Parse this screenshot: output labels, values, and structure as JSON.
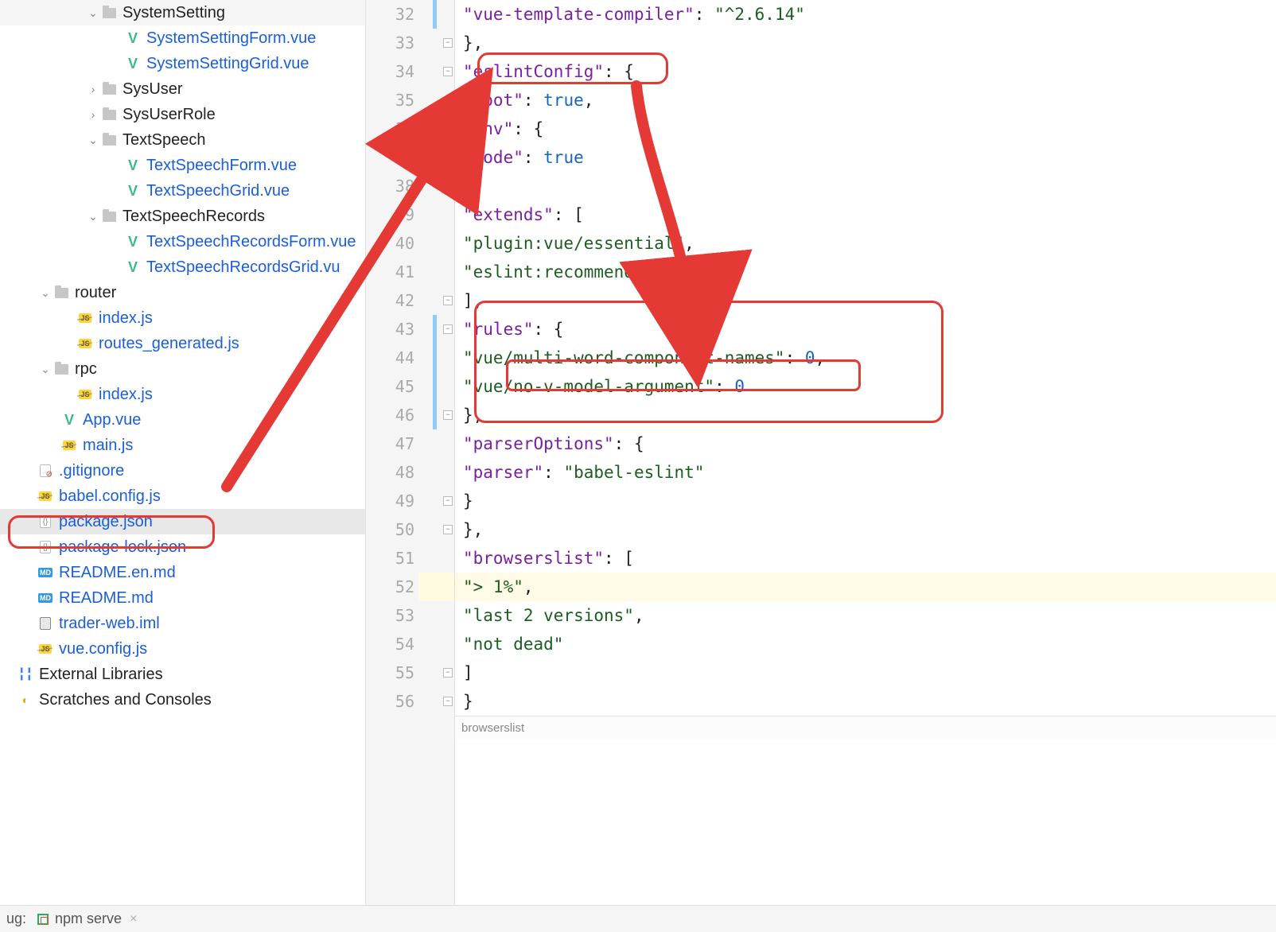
{
  "tree": [
    {
      "indent": 80,
      "arrow": "down",
      "icon": "folder",
      "label": "SystemSetting",
      "link": false
    },
    {
      "indent": 110,
      "arrow": "",
      "icon": "vue",
      "label": "SystemSettingForm.vue",
      "link": true
    },
    {
      "indent": 110,
      "arrow": "",
      "icon": "vue",
      "label": "SystemSettingGrid.vue",
      "link": true
    },
    {
      "indent": 80,
      "arrow": "right",
      "icon": "folder",
      "label": "SysUser",
      "link": false
    },
    {
      "indent": 80,
      "arrow": "right",
      "icon": "folder",
      "label": "SysUserRole",
      "link": false
    },
    {
      "indent": 80,
      "arrow": "down",
      "icon": "folder",
      "label": "TextSpeech",
      "link": false
    },
    {
      "indent": 110,
      "arrow": "",
      "icon": "vue",
      "label": "TextSpeechForm.vue",
      "link": true
    },
    {
      "indent": 110,
      "arrow": "",
      "icon": "vue",
      "label": "TextSpeechGrid.vue",
      "link": true
    },
    {
      "indent": 80,
      "arrow": "down",
      "icon": "folder",
      "label": "TextSpeechRecords",
      "link": false
    },
    {
      "indent": 110,
      "arrow": "",
      "icon": "vue",
      "label": "TextSpeechRecordsForm.vue",
      "link": true
    },
    {
      "indent": 110,
      "arrow": "",
      "icon": "vue",
      "label": "TextSpeechRecordsGrid.vu",
      "link": true
    },
    {
      "indent": 20,
      "arrow": "down",
      "icon": "folder",
      "label": "router",
      "link": false
    },
    {
      "indent": 50,
      "arrow": "",
      "icon": "js-strike",
      "label": "index.js",
      "link": true
    },
    {
      "indent": 50,
      "arrow": "",
      "icon": "js-strike",
      "label": "routes_generated.js",
      "link": true
    },
    {
      "indent": 20,
      "arrow": "down",
      "icon": "folder",
      "label": "rpc",
      "link": false
    },
    {
      "indent": 50,
      "arrow": "",
      "icon": "js-strike",
      "label": "index.js",
      "link": true
    },
    {
      "indent": 30,
      "arrow": "",
      "icon": "vue",
      "label": "App.vue",
      "link": true
    },
    {
      "indent": 30,
      "arrow": "",
      "icon": "js-strike",
      "label": "main.js",
      "link": true
    },
    {
      "indent": 0,
      "arrow": "",
      "icon": "gitignore",
      "label": ".gitignore",
      "link": true
    },
    {
      "indent": 0,
      "arrow": "",
      "icon": "js-strike",
      "label": "babel.config.js",
      "link": true
    },
    {
      "indent": 0,
      "arrow": "",
      "icon": "json",
      "label": "package.json",
      "link": true,
      "selected": true
    },
    {
      "indent": 0,
      "arrow": "",
      "icon": "json",
      "label": "package-lock.json",
      "link": true
    },
    {
      "indent": 0,
      "arrow": "",
      "icon": "md",
      "label": "README.en.md",
      "link": true
    },
    {
      "indent": 0,
      "arrow": "",
      "icon": "md",
      "label": "README.md",
      "link": true
    },
    {
      "indent": 0,
      "arrow": "",
      "icon": "iml",
      "label": "trader-web.iml",
      "link": true
    },
    {
      "indent": 0,
      "arrow": "",
      "icon": "js-strike",
      "label": "vue.config.js",
      "link": true
    },
    {
      "indent": -25,
      "arrow": "",
      "icon": "libs",
      "label": "External Libraries",
      "link": false
    },
    {
      "indent": -25,
      "arrow": "",
      "icon": "scratches",
      "label": "Scratches and Consoles",
      "link": false
    }
  ],
  "gutter": {
    "start": 32,
    "end": 56,
    "fold_open_lines": [
      33,
      34,
      38,
      42,
      43,
      46,
      49,
      50,
      55,
      56
    ],
    "fold_close_lines": [
      36
    ],
    "change_mark_lines": [
      32,
      43,
      44,
      45,
      46
    ],
    "current_line": 52
  },
  "code": [
    {
      "n": 32,
      "indent": 3,
      "tokens": [
        [
          "key",
          "\"vue-template-compiler\""
        ],
        [
          "punct",
          ": "
        ],
        [
          "str",
          "\"^2.6.14\""
        ]
      ]
    },
    {
      "n": 33,
      "indent": 2,
      "tokens": [
        [
          "punct",
          "},"
        ]
      ]
    },
    {
      "n": 34,
      "indent": 2,
      "tokens": [
        [
          "key",
          "\"eslintConfig\""
        ],
        [
          "punct",
          ": {"
        ]
      ]
    },
    {
      "n": 35,
      "indent": 3,
      "tokens": [
        [
          "key",
          "\"root\""
        ],
        [
          "punct",
          ": "
        ],
        [
          "bool",
          "true"
        ],
        [
          "punct",
          ","
        ]
      ]
    },
    {
      "n": 36,
      "indent": 3,
      "tokens": [
        [
          "key",
          "\"env\""
        ],
        [
          "punct",
          ": {"
        ]
      ]
    },
    {
      "n": 37,
      "indent": 4,
      "tokens": [
        [
          "key",
          "\"node\""
        ],
        [
          "punct",
          ": "
        ],
        [
          "bool",
          "true"
        ]
      ]
    },
    {
      "n": 38,
      "indent": 3,
      "tokens": [
        [
          "punct",
          "},"
        ]
      ]
    },
    {
      "n": 39,
      "indent": 3,
      "tokens": [
        [
          "key",
          "\"extends\""
        ],
        [
          "punct",
          ": ["
        ]
      ]
    },
    {
      "n": 40,
      "indent": 4,
      "tokens": [
        [
          "str",
          "\"plugin:vue/essential\""
        ],
        [
          "punct",
          ","
        ]
      ]
    },
    {
      "n": 41,
      "indent": 4,
      "tokens": [
        [
          "str",
          "\"eslint:recommended\""
        ]
      ]
    },
    {
      "n": 42,
      "indent": 3,
      "tokens": [
        [
          "punct",
          "],"
        ]
      ]
    },
    {
      "n": 43,
      "indent": 3,
      "tokens": [
        [
          "key",
          "\"rules\""
        ],
        [
          "punct",
          ": {"
        ]
      ]
    },
    {
      "n": 44,
      "indent": 4,
      "tokens": [
        [
          "str",
          "\"vue/multi-word-component-names\""
        ],
        [
          "punct",
          ": "
        ],
        [
          "num",
          "0"
        ],
        [
          "punct",
          ","
        ]
      ]
    },
    {
      "n": 45,
      "indent": 4,
      "tokens": [
        [
          "str",
          "\"vue/no-v-model-argument\""
        ],
        [
          "punct",
          ": "
        ],
        [
          "num",
          "0"
        ]
      ]
    },
    {
      "n": 46,
      "indent": 3,
      "tokens": [
        [
          "punct",
          "},"
        ]
      ]
    },
    {
      "n": 47,
      "indent": 3,
      "tokens": [
        [
          "key",
          "\"parserOptions\""
        ],
        [
          "punct",
          ": {"
        ]
      ]
    },
    {
      "n": 48,
      "indent": 4,
      "tokens": [
        [
          "key",
          "\"parser\""
        ],
        [
          "punct",
          ": "
        ],
        [
          "str",
          "\"babel-eslint\""
        ]
      ]
    },
    {
      "n": 49,
      "indent": 3,
      "tokens": [
        [
          "punct",
          "}"
        ]
      ]
    },
    {
      "n": 50,
      "indent": 2,
      "tokens": [
        [
          "punct",
          "},"
        ]
      ]
    },
    {
      "n": 51,
      "indent": 2,
      "tokens": [
        [
          "key",
          "\"browserslist\""
        ],
        [
          "punct",
          ": ["
        ]
      ]
    },
    {
      "n": 52,
      "indent": 3,
      "tokens": [
        [
          "str",
          "\"> 1%\""
        ],
        [
          "punct",
          ","
        ]
      ],
      "current": true
    },
    {
      "n": 53,
      "indent": 3,
      "tokens": [
        [
          "str",
          "\"last 2 versions\""
        ],
        [
          "punct",
          ","
        ]
      ]
    },
    {
      "n": 54,
      "indent": 3,
      "tokens": [
        [
          "str",
          "\"not dead\""
        ]
      ]
    },
    {
      "n": 55,
      "indent": 2,
      "tokens": [
        [
          "punct",
          "]"
        ]
      ]
    },
    {
      "n": 56,
      "indent": 1,
      "tokens": [
        [
          "punct",
          "}"
        ]
      ]
    }
  ],
  "breadcrumb": "browserslist",
  "bottom": {
    "ug_label": "ug:",
    "run_config": "npm serve"
  }
}
